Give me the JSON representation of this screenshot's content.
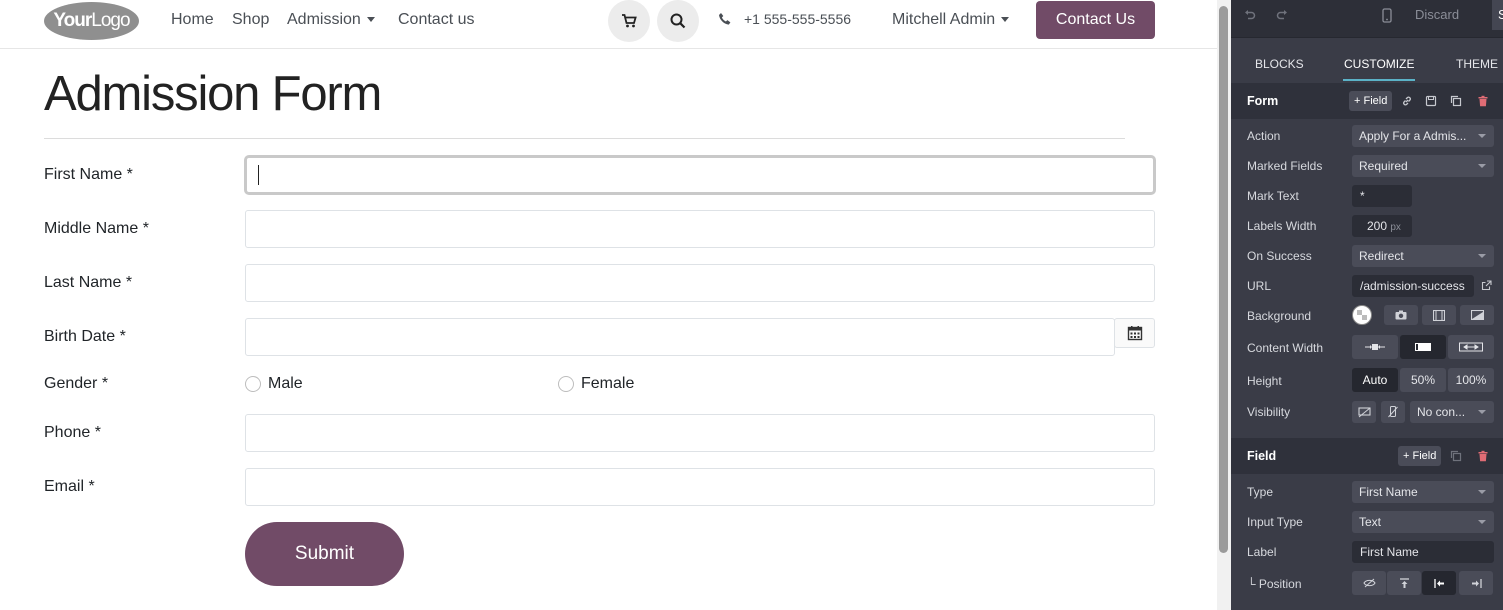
{
  "navbar": {
    "logo_bold": "Your",
    "logo_thin": "Logo",
    "links": [
      "Home",
      "Shop",
      "Admission",
      "Contact us"
    ],
    "phone": "+1 555-555-5556",
    "user": "Mitchell Admin",
    "cta": "Contact Us"
  },
  "form": {
    "title": "Admission Form",
    "fields": [
      {
        "label": "First Name *",
        "value": ""
      },
      {
        "label": "Middle Name *",
        "value": ""
      },
      {
        "label": "Last Name *",
        "value": ""
      },
      {
        "label": "Birth Date *",
        "value": ""
      },
      {
        "label": "Gender *"
      },
      {
        "label": "Phone *",
        "value": ""
      },
      {
        "label": "Email *",
        "value": ""
      }
    ],
    "gender_options": [
      "Male",
      "Female"
    ],
    "submit": "Submit"
  },
  "editor": {
    "discard": "Discard",
    "save": "Save",
    "tabs": [
      "BLOCKS",
      "CUSTOMIZE",
      "THEME"
    ],
    "active_tab": "CUSTOMIZE",
    "form_section": {
      "title": "Form",
      "add_field": "+ Field",
      "rows": {
        "action": {
          "label": "Action",
          "value": "Apply For a Admis..."
        },
        "marked_fields": {
          "label": "Marked Fields",
          "value": "Required"
        },
        "mark_text": {
          "label": "Mark Text",
          "value": "*"
        },
        "labels_width": {
          "label": "Labels Width",
          "value": "200",
          "unit": "px"
        },
        "on_success": {
          "label": "On Success",
          "value": "Redirect"
        },
        "url": {
          "label": "URL",
          "value": "/admission-success"
        },
        "background": {
          "label": "Background"
        },
        "content_width": {
          "label": "Content Width"
        },
        "height": {
          "label": "Height",
          "options": [
            "Auto",
            "50%",
            "100%"
          ],
          "selected": "Auto"
        },
        "visibility": {
          "label": "Visibility",
          "value": "No con..."
        }
      }
    },
    "field_section": {
      "title": "Field",
      "add_field": "+ Field",
      "rows": {
        "type": {
          "label": "Type",
          "value": "First Name"
        },
        "input_type": {
          "label": "Input Type",
          "value": "Text"
        },
        "label": {
          "label": "Label",
          "value": "First Name"
        },
        "position": {
          "label": "└ Position"
        }
      }
    }
  },
  "colors": {
    "brand": "#714b67",
    "editor_bg": "#3a3c47",
    "delete": "#e06c75"
  }
}
